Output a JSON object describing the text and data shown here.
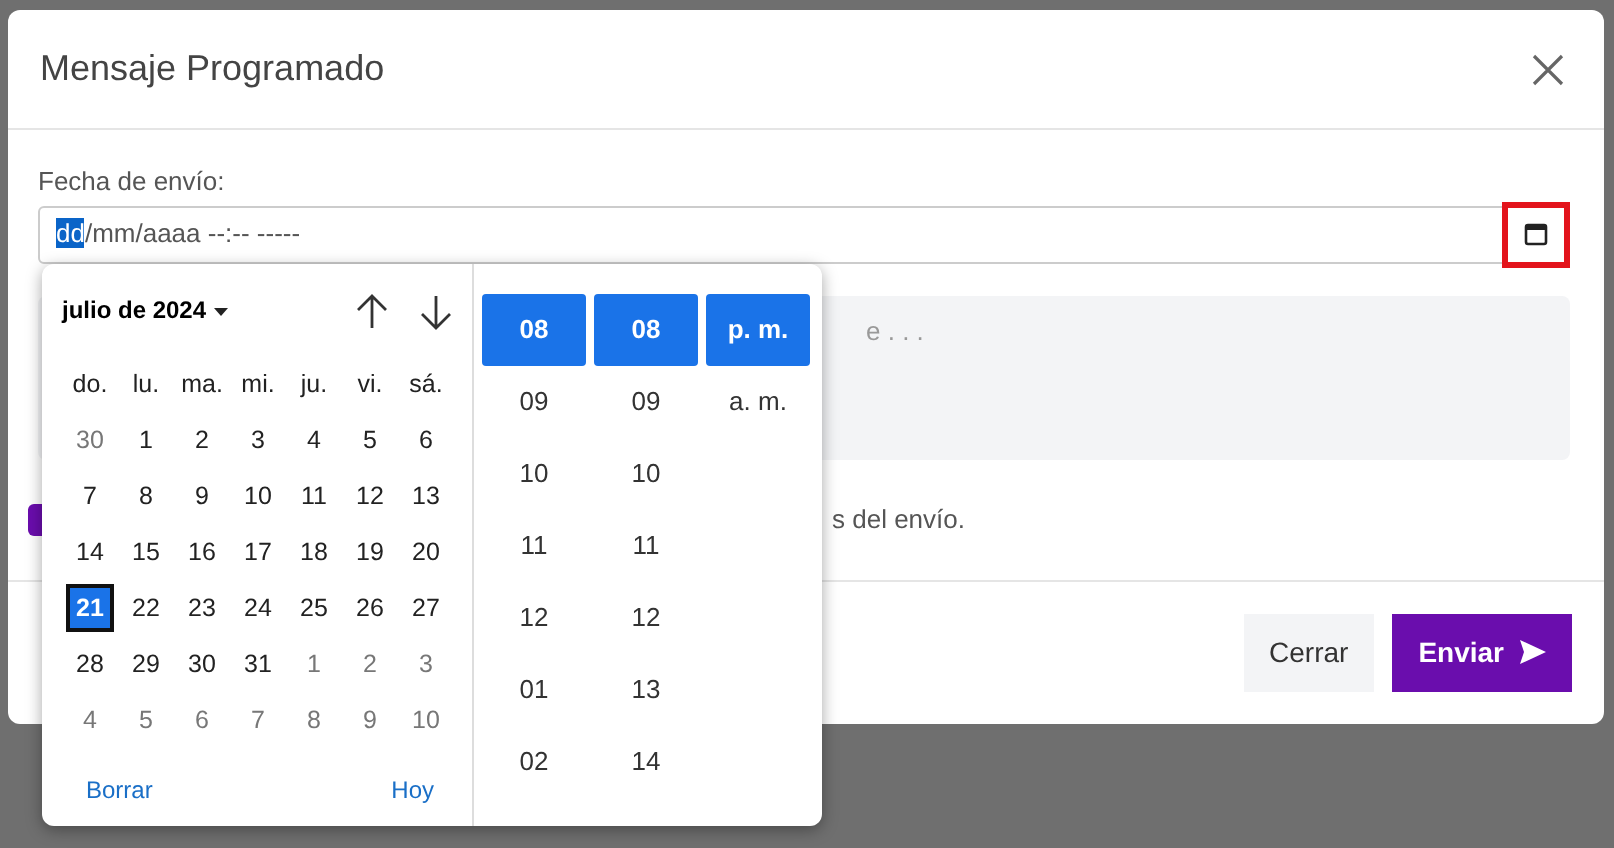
{
  "modal": {
    "title": "Mensaje Programado"
  },
  "date_field": {
    "label": "Fecha de envío:",
    "segments": [
      {
        "text": "dd",
        "selected": true
      },
      {
        "text": "/mm/aaaa --:--  -----",
        "selected": false
      }
    ],
    "picker_highlighted": true
  },
  "message": {
    "placeholder": "e . . ."
  },
  "option": {
    "checked": true,
    "text": "s del envío."
  },
  "buttons": [
    {
      "kind": "secondary",
      "label": "Cerrar"
    },
    {
      "kind": "primary",
      "label": "Enviar"
    }
  ],
  "picker": {
    "month_label": "julio de 2024",
    "weekdays": [
      "do.",
      "lu.",
      "ma.",
      "mi.",
      "ju.",
      "vi.",
      "sá."
    ],
    "weeks": [
      [
        {
          "text": "30",
          "muted": true,
          "selected": false
        },
        {
          "text": "1",
          "muted": false,
          "selected": false
        },
        {
          "text": "2",
          "muted": false,
          "selected": false
        },
        {
          "text": "3",
          "muted": false,
          "selected": false
        },
        {
          "text": "4",
          "muted": false,
          "selected": false
        },
        {
          "text": "5",
          "muted": false,
          "selected": false
        },
        {
          "text": "6",
          "muted": false,
          "selected": false
        }
      ],
      [
        {
          "text": "7",
          "muted": false,
          "selected": false
        },
        {
          "text": "8",
          "muted": false,
          "selected": false
        },
        {
          "text": "9",
          "muted": false,
          "selected": false
        },
        {
          "text": "10",
          "muted": false,
          "selected": false
        },
        {
          "text": "11",
          "muted": false,
          "selected": false
        },
        {
          "text": "12",
          "muted": false,
          "selected": false
        },
        {
          "text": "13",
          "muted": false,
          "selected": false
        }
      ],
      [
        {
          "text": "14",
          "muted": false,
          "selected": false
        },
        {
          "text": "15",
          "muted": false,
          "selected": false
        },
        {
          "text": "16",
          "muted": false,
          "selected": false
        },
        {
          "text": "17",
          "muted": false,
          "selected": false
        },
        {
          "text": "18",
          "muted": false,
          "selected": false
        },
        {
          "text": "19",
          "muted": false,
          "selected": false
        },
        {
          "text": "20",
          "muted": false,
          "selected": false
        }
      ],
      [
        {
          "text": "21",
          "muted": false,
          "selected": true
        },
        {
          "text": "22",
          "muted": false,
          "selected": false
        },
        {
          "text": "23",
          "muted": false,
          "selected": false
        },
        {
          "text": "24",
          "muted": false,
          "selected": false
        },
        {
          "text": "25",
          "muted": false,
          "selected": false
        },
        {
          "text": "26",
          "muted": false,
          "selected": false
        },
        {
          "text": "27",
          "muted": false,
          "selected": false
        }
      ],
      [
        {
          "text": "28",
          "muted": false,
          "selected": false
        },
        {
          "text": "29",
          "muted": false,
          "selected": false
        },
        {
          "text": "30",
          "muted": false,
          "selected": false
        },
        {
          "text": "31",
          "muted": false,
          "selected": false
        },
        {
          "text": "1",
          "muted": true,
          "selected": false
        },
        {
          "text": "2",
          "muted": true,
          "selected": false
        },
        {
          "text": "3",
          "muted": true,
          "selected": false
        }
      ],
      [
        {
          "text": "4",
          "muted": true,
          "selected": false
        },
        {
          "text": "5",
          "muted": true,
          "selected": false
        },
        {
          "text": "6",
          "muted": true,
          "selected": false
        },
        {
          "text": "7",
          "muted": true,
          "selected": false
        },
        {
          "text": "8",
          "muted": true,
          "selected": false
        },
        {
          "text": "9",
          "muted": true,
          "selected": false
        },
        {
          "text": "10",
          "muted": true,
          "selected": false
        }
      ]
    ],
    "clear_label": "Borrar",
    "today_label": "Hoy",
    "time_columns": [
      {
        "items": [
          {
            "text": "08",
            "selected": true
          },
          {
            "text": "09",
            "selected": false
          },
          {
            "text": "10",
            "selected": false
          },
          {
            "text": "11",
            "selected": false
          },
          {
            "text": "12",
            "selected": false
          },
          {
            "text": "01",
            "selected": false
          },
          {
            "text": "02",
            "selected": false
          }
        ]
      },
      {
        "items": [
          {
            "text": "08",
            "selected": true
          },
          {
            "text": "09",
            "selected": false
          },
          {
            "text": "10",
            "selected": false
          },
          {
            "text": "11",
            "selected": false
          },
          {
            "text": "12",
            "selected": false
          },
          {
            "text": "13",
            "selected": false
          },
          {
            "text": "14",
            "selected": false
          }
        ]
      },
      {
        "items": [
          {
            "text": "p. m.",
            "selected": true
          },
          {
            "text": "a. m.",
            "selected": false
          }
        ]
      }
    ]
  }
}
